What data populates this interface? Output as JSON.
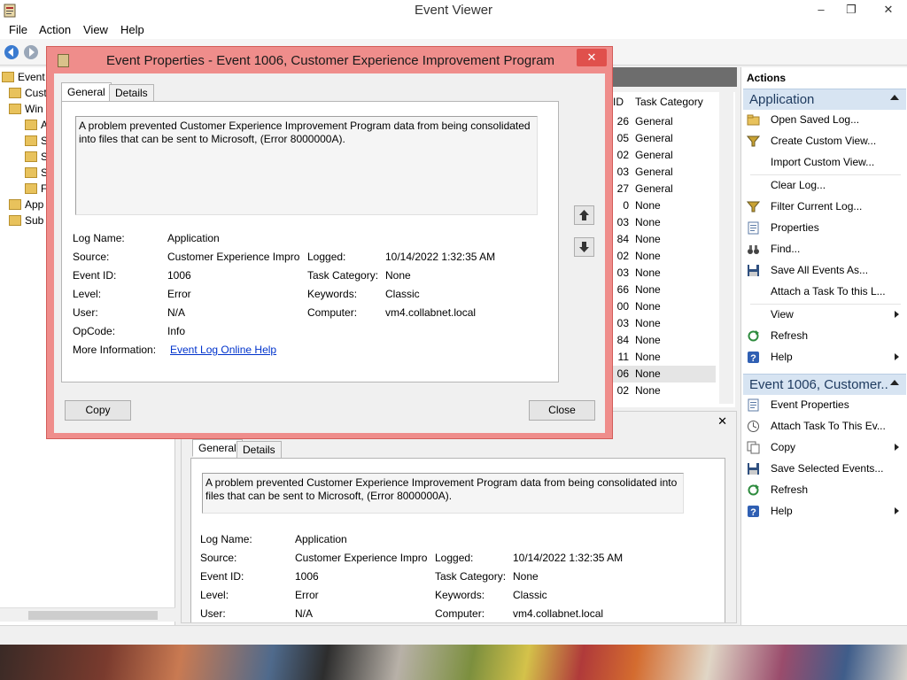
{
  "window": {
    "title": "Event Viewer",
    "minimize": "–",
    "restore": "❐",
    "close": "✕"
  },
  "menu": [
    "File",
    "Action",
    "View",
    "Help"
  ],
  "tree": {
    "items": [
      "Event V",
      "Cust",
      "Win",
      "A",
      "S",
      "S",
      "S",
      "F",
      "App",
      "Sub"
    ]
  },
  "list": {
    "col_id": "ID",
    "col_task": "Task Category",
    "rows": [
      {
        "id": "26",
        "task": "General"
      },
      {
        "id": "05",
        "task": "General"
      },
      {
        "id": "02",
        "task": "General"
      },
      {
        "id": "03",
        "task": "General"
      },
      {
        "id": "27",
        "task": "General"
      },
      {
        "id": "0",
        "task": "None"
      },
      {
        "id": "03",
        "task": "None"
      },
      {
        "id": "84",
        "task": "None"
      },
      {
        "id": "02",
        "task": "None"
      },
      {
        "id": "03",
        "task": "None"
      },
      {
        "id": "66",
        "task": "None"
      },
      {
        "id": "00",
        "task": "None"
      },
      {
        "id": "03",
        "task": "None"
      },
      {
        "id": "84",
        "task": "None"
      },
      {
        "id": "11",
        "task": "None"
      },
      {
        "id": "06",
        "task": "None"
      },
      {
        "id": "02",
        "task": "None"
      }
    ],
    "selected_index": 15
  },
  "event": {
    "message": "A problem prevented Customer Experience Improvement Program data from being consolidated into files that can be sent to Microsoft, (Error 8000000A).",
    "labels": {
      "log_name": "Log Name:",
      "source": "Source:",
      "event_id": "Event ID:",
      "level": "Level:",
      "user": "User:",
      "opcode": "OpCode:",
      "more_info": "More Information:",
      "logged": "Logged:",
      "task_category": "Task Category:",
      "keywords": "Keywords:",
      "computer": "Computer:"
    },
    "values": {
      "log_name": "Application",
      "source": "Customer Experience Improv",
      "event_id": "1006",
      "level": "Error",
      "user": "N/A",
      "opcode": "Info",
      "more_info": "Event Log Online Help",
      "logged": "10/14/2022 1:32:35 AM",
      "task_category": "None",
      "keywords": "Classic",
      "computer": "vm4.collabnet.local"
    }
  },
  "tabs": {
    "general": "General",
    "details": "Details"
  },
  "preview": {
    "close": "✕"
  },
  "dialog": {
    "title": "Event Properties - Event 1006, Customer Experience Improvement Program",
    "close": "✕",
    "copy": "Copy",
    "close_button": "Close"
  },
  "actions": {
    "heading": "Actions",
    "section1": "Application",
    "items1": [
      {
        "label": "Open Saved Log...",
        "icon": "folder-icon"
      },
      {
        "label": "Create Custom View...",
        "icon": "filter-icon"
      },
      {
        "label": "Import Custom View...",
        "icon": ""
      },
      {
        "label": "Clear Log...",
        "icon": ""
      },
      {
        "label": "Filter Current Log...",
        "icon": "filter-icon"
      },
      {
        "label": "Properties",
        "icon": "properties-icon"
      },
      {
        "label": "Find...",
        "icon": "binoculars-icon"
      },
      {
        "label": "Save All Events As...",
        "icon": "save-icon"
      },
      {
        "label": "Attach a Task To this L...",
        "icon": ""
      },
      {
        "label": "View",
        "icon": ""
      },
      {
        "label": "Refresh",
        "icon": "refresh-icon"
      },
      {
        "label": "Help",
        "icon": "help-icon"
      }
    ],
    "section2": "Event 1006, Customer...",
    "items2": [
      {
        "label": "Event Properties",
        "icon": "properties-icon"
      },
      {
        "label": "Attach Task To This Ev...",
        "icon": "task-icon"
      },
      {
        "label": "Copy",
        "icon": "copy-icon"
      },
      {
        "label": "Save Selected Events...",
        "icon": "save-icon"
      },
      {
        "label": "Refresh",
        "icon": "refresh-icon"
      },
      {
        "label": "Help",
        "icon": "help-icon"
      }
    ]
  },
  "colors": {
    "dialog_frame": "#ef8d8b",
    "dialog_close": "#e0504c",
    "action_section": "#d7e4f2",
    "link": "#0033cc"
  }
}
